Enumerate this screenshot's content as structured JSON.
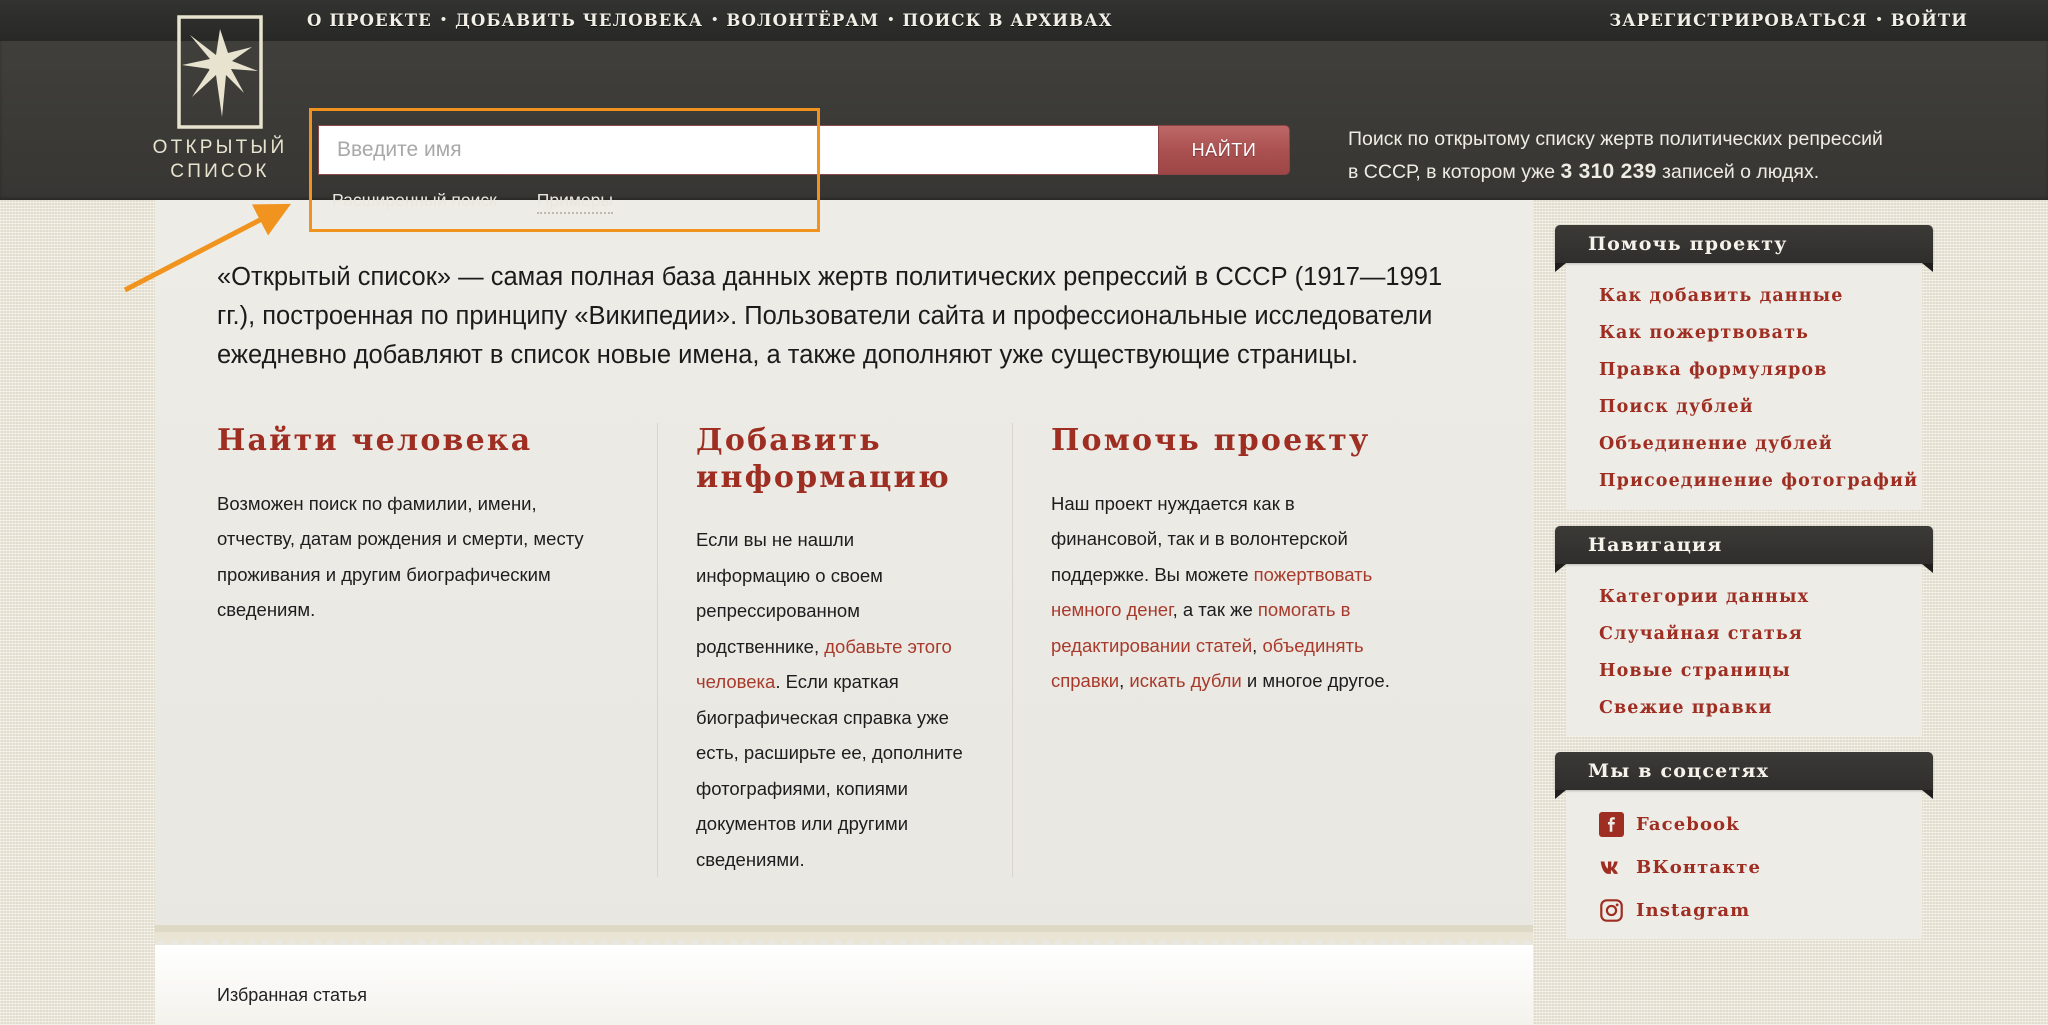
{
  "topnav": {
    "left_links": [
      "О ПРОЕКТЕ",
      "ДОБАВИТЬ ЧЕЛОВЕКА",
      "ВОЛОНТЁРАМ",
      "ПОИСК В АРХИВАХ"
    ],
    "right_links": [
      "ЗАРЕГИСТРИРОВАТЬСЯ",
      "ВОЙТИ"
    ],
    "separator": "•"
  },
  "logo": {
    "text": "ОТКРЫТЫЙ\nСПИСОК",
    "icon": "swallow-in-frame-icon"
  },
  "search": {
    "placeholder": "Введите имя",
    "value": "",
    "button_label": "НАЙТИ",
    "advanced_label": "Расширенный поиск",
    "examples_label": "Примеры"
  },
  "header_blurb": {
    "line1": "Поиск по открытому списку жертв политических репрессий",
    "line2_before": "в СССР, в котором уже ",
    "count": "3 310 239",
    "line2_after": " записей о людях."
  },
  "intro": "«Открытый список» — самая полная база данных жертв политических репрессий в СССР (1917—1991 гг.), построенная по принципу «Википедии». Пользователи сайта и профессиональные исследователи ежедневно добавляют в список новые имена, а также дополняют уже существующие страницы.",
  "columns": [
    {
      "title": "Найти человека",
      "parts": [
        {
          "text": "Возможен поиск по фамилии, имени, отчеству, датам рождения и смерти, месту проживания и другим биографическим сведениям.",
          "link": false
        }
      ]
    },
    {
      "title": "Добавить информацию",
      "parts": [
        {
          "text": "Если вы не нашли информацию о своем репрессированном родственнике, ",
          "link": false
        },
        {
          "text": "добавьте этого человека",
          "link": true
        },
        {
          "text": ". Если краткая биографическая справка уже есть, расширьте ее, дополните фотографиями, копиями документов или другими сведениями.",
          "link": false
        }
      ]
    },
    {
      "title": "Помочь проекту",
      "parts": [
        {
          "text": "Наш проект нуждается как в финансовой, так и в волонтерской поддержке. Вы можете ",
          "link": false
        },
        {
          "text": "пожертвовать немного денег",
          "link": true
        },
        {
          "text": ", а так же ",
          "link": false
        },
        {
          "text": "помогать в редактировании статей",
          "link": true
        },
        {
          "text": ", ",
          "link": false
        },
        {
          "text": "объединять справки",
          "link": true
        },
        {
          "text": ", ",
          "link": false
        },
        {
          "text": "искать дубли",
          "link": true
        },
        {
          "text": " и многое другое.",
          "link": false
        }
      ]
    }
  ],
  "featured": {
    "label": "Избранная статья"
  },
  "sidebar": {
    "widgets": [
      {
        "title": "Помочь проекту",
        "links": [
          "Как добавить данные",
          "Как пожертвовать",
          "Правка формуляров",
          "Поиск дублей",
          "Объединение дублей",
          "Присоединение фотографий"
        ]
      },
      {
        "title": "Навигация",
        "links": [
          "Категории данных",
          "Случайная статья",
          "Новые страницы",
          "Свежие правки"
        ]
      }
    ],
    "social": {
      "title": "Мы в соцсетях",
      "links": [
        {
          "label": "Facebook",
          "icon": "facebook-icon"
        },
        {
          "label": "ВКонтакте",
          "icon": "vk-icon"
        },
        {
          "label": "Instagram",
          "icon": "instagram-icon"
        }
      ]
    }
  },
  "annotation": {
    "arrow": "orange-arrow-pointing-to-search-box"
  },
  "colors": {
    "accent_red": "#9e2d22",
    "link_red": "#a83a2c",
    "highlight_orange": "#ef931e",
    "header_dark": "#3b3a37",
    "page_bg": "#e9e4d4"
  }
}
